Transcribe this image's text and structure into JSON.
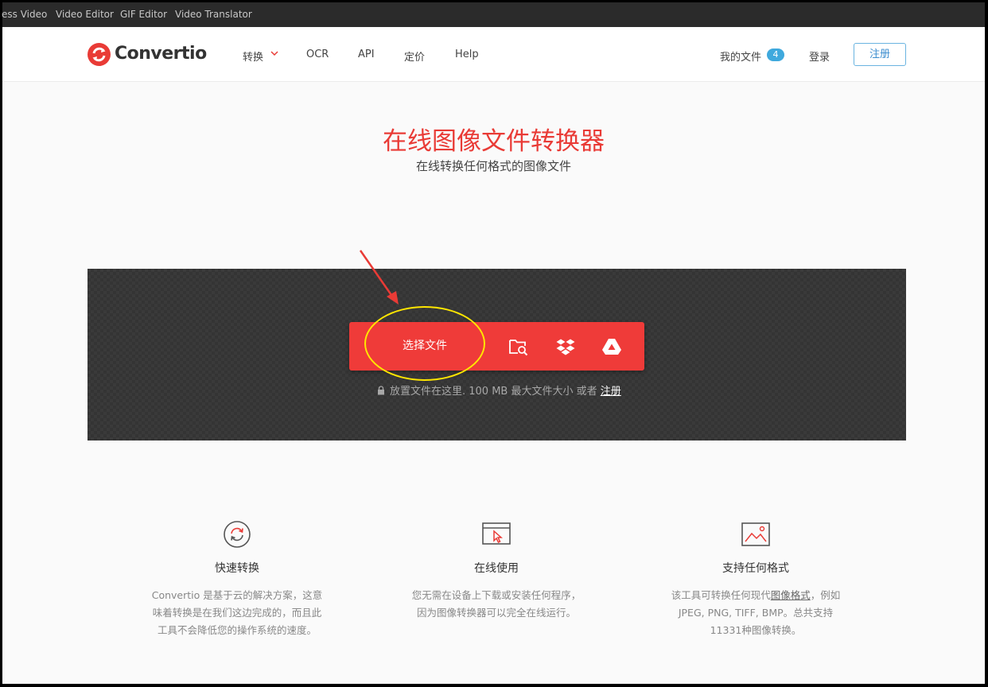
{
  "topbar": {
    "items": [
      "ess Video",
      "Video Editor",
      "GIF Editor",
      "Video Translator"
    ]
  },
  "navbar": {
    "logo_text": "Convertio",
    "convert": "转换",
    "ocr": "OCR",
    "api": "API",
    "pricing": "定价",
    "help": "Help",
    "my_files": "我的文件",
    "files_count": "4",
    "login": "登录",
    "signup": "注册"
  },
  "hero": {
    "title": "在线图像文件转换器",
    "subtitle": "在线转换任何格式的图像文件"
  },
  "dropzone": {
    "choose_files": "选择文件",
    "hint_text": "放置文件在这里. 100 MB 最大文件大小 或者",
    "hint_link": "注册",
    "sources": [
      "folder-search-icon",
      "dropbox-icon",
      "google-drive-icon"
    ]
  },
  "features": [
    {
      "icon": "refresh-circle-icon",
      "title": "快速转换",
      "lines": [
        "Convertio 是基于云的解决方案，这意",
        "味着转换是在我们这边完成的，而且此",
        "工具不会降低您的操作系统的速度。"
      ]
    },
    {
      "icon": "browser-cursor-icon",
      "title": "在线使用",
      "lines": [
        "您无需在设备上下载或安装任何程序，",
        "因为图像转换器可以完全在线运行。"
      ]
    },
    {
      "icon": "image-icon",
      "title": "支持任何格式",
      "line1_pre": "该工具可转换任何现代",
      "line1_link": "图像格式",
      "line1_post": "，例如",
      "line2": "JPEG, PNG, TIFF, BMP。总共支持",
      "line3": "11331种图像转换。"
    }
  ],
  "colors": {
    "brand_red": "#e93b36",
    "badge_blue": "#3fa9dd",
    "annotation_yellow": "#ffe600"
  }
}
